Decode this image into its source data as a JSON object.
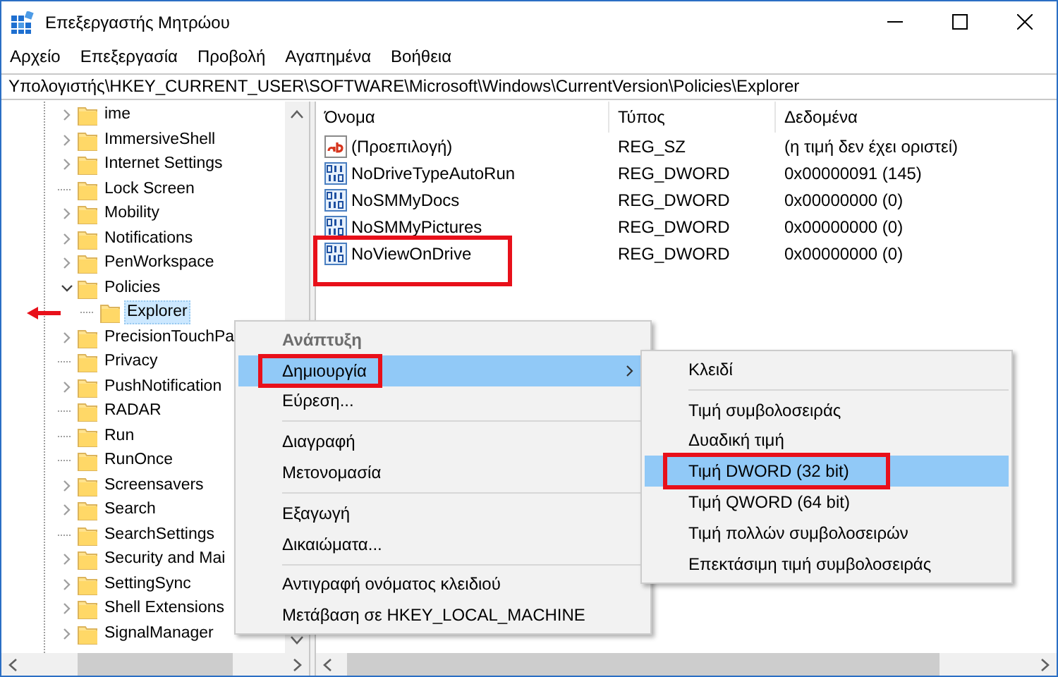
{
  "window": {
    "title": "Επεξεργαστής Μητρώου"
  },
  "menu_bar": [
    "Αρχείο",
    "Επεξεργασία",
    "Προβολή",
    "Αγαπημένα",
    "Βοήθεια"
  ],
  "address_bar": {
    "value": "Υπολογιστής\\HKEY_CURRENT_USER\\SOFTWARE\\Microsoft\\Windows\\CurrentVersion\\Policies\\Explorer"
  },
  "tree": {
    "items": [
      {
        "label": "ime",
        "kind": "branch",
        "expanded": false,
        "selected": false,
        "pointed": false
      },
      {
        "label": "ImmersiveShell",
        "kind": "branch",
        "expanded": false,
        "selected": false,
        "pointed": false
      },
      {
        "label": "Internet Settings",
        "kind": "branch",
        "expanded": false,
        "selected": false,
        "pointed": false
      },
      {
        "label": "Lock Screen",
        "kind": "leaf",
        "selected": false,
        "pointed": false
      },
      {
        "label": "Mobility",
        "kind": "branch",
        "expanded": false,
        "selected": false,
        "pointed": false
      },
      {
        "label": "Notifications",
        "kind": "branch",
        "expanded": false,
        "selected": false,
        "pointed": false
      },
      {
        "label": "PenWorkspace",
        "kind": "branch",
        "expanded": false,
        "selected": false,
        "pointed": false
      },
      {
        "label": "Policies",
        "kind": "branch",
        "expanded": true,
        "selected": false,
        "pointed": false,
        "children": [
          {
            "label": "Explorer",
            "kind": "leaf",
            "selected": true,
            "pointed": true
          }
        ]
      },
      {
        "label": "PrecisionTouchPa",
        "kind": "branch",
        "expanded": false,
        "selected": false,
        "pointed": false
      },
      {
        "label": "Privacy",
        "kind": "leaf",
        "selected": false,
        "pointed": false
      },
      {
        "label": "PushNotification",
        "kind": "branch",
        "expanded": false,
        "selected": false,
        "pointed": false
      },
      {
        "label": "RADAR",
        "kind": "leaf",
        "selected": false,
        "pointed": false
      },
      {
        "label": "Run",
        "kind": "leaf",
        "selected": false,
        "pointed": false
      },
      {
        "label": "RunOnce",
        "kind": "leaf",
        "selected": false,
        "pointed": false
      },
      {
        "label": "Screensavers",
        "kind": "branch",
        "expanded": false,
        "selected": false,
        "pointed": false
      },
      {
        "label": "Search",
        "kind": "branch",
        "expanded": false,
        "selected": false,
        "pointed": false
      },
      {
        "label": "SearchSettings",
        "kind": "leaf",
        "selected": false,
        "pointed": false
      },
      {
        "label": "Security and Mai",
        "kind": "branch",
        "expanded": false,
        "selected": false,
        "pointed": false
      },
      {
        "label": "SettingSync",
        "kind": "branch",
        "expanded": false,
        "selected": false,
        "pointed": false
      },
      {
        "label": "Shell Extensions",
        "kind": "branch",
        "expanded": false,
        "selected": false,
        "pointed": false
      },
      {
        "label": "SignalManager",
        "kind": "branch",
        "expanded": false,
        "selected": false,
        "pointed": false
      }
    ]
  },
  "values_table": {
    "columns": [
      "Όνομα",
      "Τύπος",
      "Δεδομένα"
    ],
    "rows": [
      {
        "kind": "string",
        "name": "(Προεπιλογή)",
        "type": "REG_SZ",
        "data": "(η τιμή δεν έχει οριστεί)",
        "highlighted": false
      },
      {
        "kind": "binary",
        "name": "NoDriveTypeAutoRun",
        "type": "REG_DWORD",
        "data": "0x00000091 (145)",
        "highlighted": false
      },
      {
        "kind": "binary",
        "name": "NoSMMyDocs",
        "type": "REG_DWORD",
        "data": "0x00000000 (0)",
        "highlighted": false
      },
      {
        "kind": "binary",
        "name": "NoSMMyPictures",
        "type": "REG_DWORD",
        "data": "0x00000000 (0)",
        "highlighted": false
      },
      {
        "kind": "binary",
        "name": "NoViewOnDrive",
        "type": "REG_DWORD",
        "data": "0x00000000 (0)",
        "highlighted": true
      }
    ]
  },
  "context_menu": {
    "items": [
      {
        "kind": "item",
        "label": "Ανάπτυξη",
        "default": true,
        "disabled": true,
        "selected": false,
        "submenu": false,
        "highlighted": false
      },
      {
        "kind": "item",
        "label": "Δημιουργία",
        "default": false,
        "disabled": false,
        "selected": true,
        "submenu": true,
        "highlighted": true
      },
      {
        "kind": "item",
        "label": "Εύρεση...",
        "default": false,
        "disabled": false,
        "selected": false,
        "submenu": false,
        "highlighted": false
      },
      {
        "kind": "separator"
      },
      {
        "kind": "item",
        "label": "Διαγραφή",
        "default": false,
        "disabled": false,
        "selected": false,
        "submenu": false,
        "highlighted": false
      },
      {
        "kind": "item",
        "label": "Μετονομασία",
        "default": false,
        "disabled": false,
        "selected": false,
        "submenu": false,
        "highlighted": false
      },
      {
        "kind": "separator"
      },
      {
        "kind": "item",
        "label": "Εξαγωγή",
        "default": false,
        "disabled": false,
        "selected": false,
        "submenu": false,
        "highlighted": false
      },
      {
        "kind": "item",
        "label": "Δικαιώματα...",
        "default": false,
        "disabled": false,
        "selected": false,
        "submenu": false,
        "highlighted": false
      },
      {
        "kind": "separator"
      },
      {
        "kind": "item",
        "label": "Αντιγραφή ονόματος κλειδιού",
        "default": false,
        "disabled": false,
        "selected": false,
        "submenu": false,
        "highlighted": false
      },
      {
        "kind": "item",
        "label": "Μετάβαση σε HKEY_LOCAL_MACHINE",
        "default": false,
        "disabled": false,
        "selected": false,
        "submenu": false,
        "highlighted": false
      }
    ]
  },
  "submenu": {
    "items": [
      {
        "kind": "item",
        "label": "Κλειδί",
        "selected": false,
        "highlighted": false
      },
      {
        "kind": "separator"
      },
      {
        "kind": "item",
        "label": "Τιμή συμβολοσειράς",
        "selected": false,
        "highlighted": false
      },
      {
        "kind": "item",
        "label": "Δυαδική τιμή",
        "selected": false,
        "highlighted": false
      },
      {
        "kind": "item",
        "label": "Τιμή DWORD (32 bit)",
        "selected": true,
        "highlighted": true
      },
      {
        "kind": "item",
        "label": "Τιμή QWORD (64 bit)",
        "selected": false,
        "highlighted": false
      },
      {
        "kind": "item",
        "label": "Τιμή πολλών συμβολοσειρών",
        "selected": false,
        "highlighted": false
      },
      {
        "kind": "item",
        "label": "Επεκτάσιμη τιμή συμβολοσειράς",
        "selected": false,
        "highlighted": false
      }
    ]
  }
}
